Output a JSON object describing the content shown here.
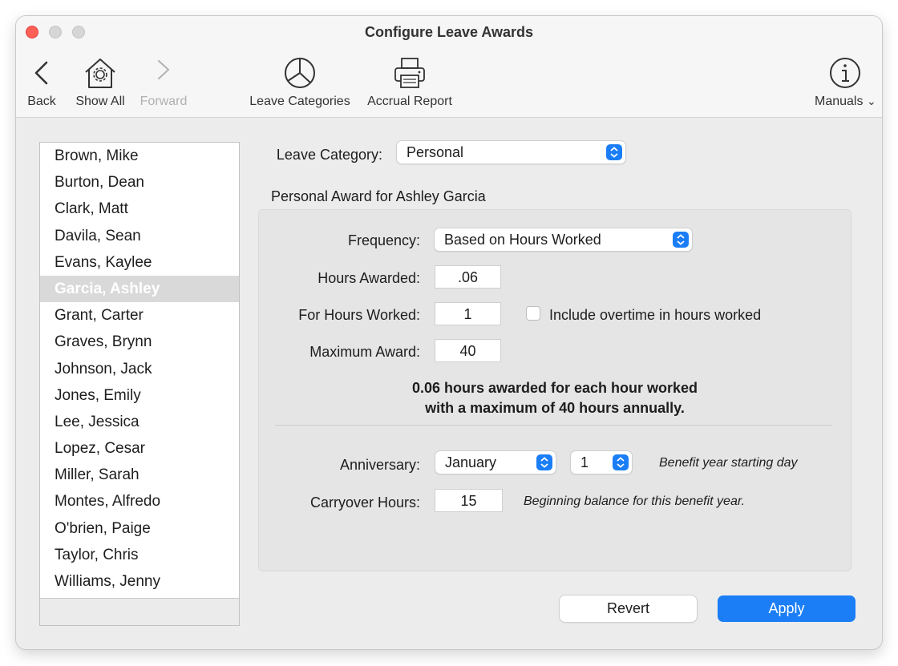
{
  "window": {
    "title": "Configure Leave Awards"
  },
  "toolbar": {
    "back": "Back",
    "show_all": "Show All",
    "forward": "Forward",
    "leave_categories": "Leave Categories",
    "accrual_report": "Accrual Report",
    "manuals": "Manuals",
    "manuals_chevron": "⌄"
  },
  "employees": [
    "Brown, Mike",
    "Burton, Dean",
    "Clark, Matt",
    "Davila, Sean",
    "Evans, Kaylee",
    "Garcia, Ashley",
    "Grant, Carter",
    "Graves, Brynn",
    "Johnson, Jack",
    "Jones, Emily",
    "Lee, Jessica",
    "Lopez, Cesar",
    "Miller, Sarah",
    "Montes, Alfredo",
    "O'brien, Paige",
    "Taylor, Chris",
    "Williams, Jenny"
  ],
  "selected_employee": "Garcia, Ashley",
  "leave_category": {
    "label": "Leave Category:",
    "value": "Personal"
  },
  "award_heading": "Personal Award for Ashley Garcia",
  "award": {
    "frequency_label": "Frequency:",
    "frequency_value": "Based on Hours Worked",
    "hours_awarded_label": "Hours Awarded:",
    "hours_awarded_value": ".06",
    "hours_worked_label": "For Hours Worked:",
    "hours_worked_value": "1",
    "overtime_label": "Include overtime in hours worked",
    "overtime_checked": false,
    "max_award_label": "Maximum Award:",
    "max_award_value": "40",
    "summary_line1": "0.06 hours awarded for each hour worked",
    "summary_line2": "with a maximum of 40 hours annually.",
    "anniversary_label": "Anniversary:",
    "anniversary_month": "January",
    "anniversary_day": "1",
    "anniversary_note": "Benefit year starting day",
    "carryover_label": "Carryover Hours:",
    "carryover_value": "15",
    "carryover_note": "Beginning balance for this benefit year."
  },
  "buttons": {
    "revert": "Revert",
    "apply": "Apply"
  },
  "colors": {
    "accent": "#1b7ef6",
    "close": "#fe5f57",
    "window_bg": "#ececec"
  },
  "icons": {
    "back": "chevron-left-icon",
    "show_all": "house-gear-icon",
    "forward": "chevron-right-icon",
    "leave_categories": "pie-chart-icon",
    "accrual_report": "printer-icon",
    "manuals": "info-icon"
  }
}
